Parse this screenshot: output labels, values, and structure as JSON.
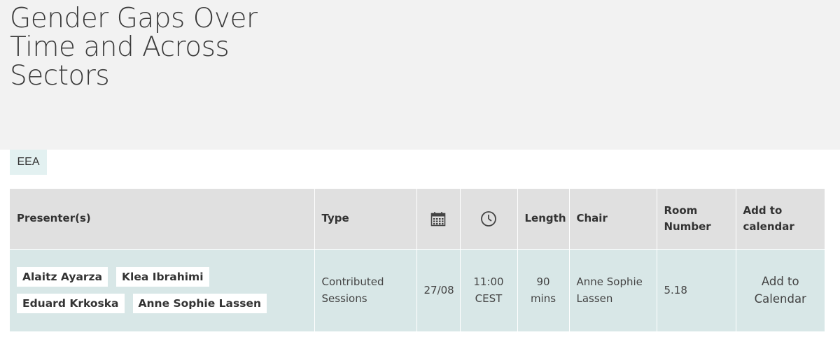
{
  "session": {
    "title": "Gender Gaps Over Time and Across Sectors",
    "tag": "EEA"
  },
  "table": {
    "headers": {
      "presenters": "Presenter(s)",
      "type": "Type",
      "date_icon": "calendar-icon",
      "time_icon": "clock-icon",
      "length": "Length",
      "chair": "Chair",
      "room": "Room Number",
      "add_to_calendar": "Add to calendar"
    },
    "row": {
      "presenters": [
        "Alaitz Ayarza",
        "Klea Ibrahimi",
        "Eduard Krkoska",
        "Anne Sophie Lassen"
      ],
      "type": "Contributed Sessions",
      "date": "27/08",
      "time": "11:00 CEST",
      "length": "90 mins",
      "chair": "Anne Sophie Lassen",
      "room": "5.18",
      "add_to_calendar": "Add to Calendar"
    }
  },
  "colors": {
    "hero_bg": "#f2f2f2",
    "header_bg": "#e0e0e0",
    "row_bg": "#d8e7e7",
    "tag_bg": "#e3f1f1"
  }
}
